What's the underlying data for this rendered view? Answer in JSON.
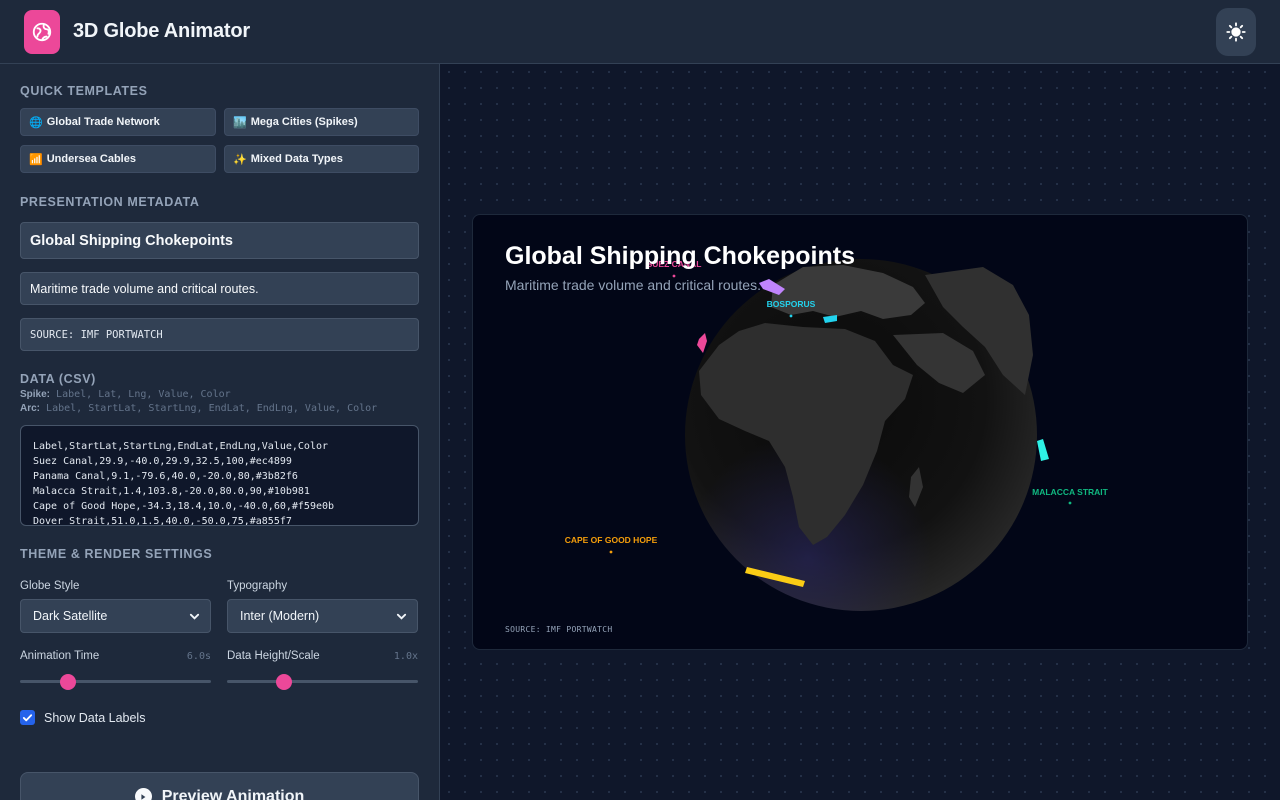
{
  "app": {
    "title": "3D Globe Animator"
  },
  "sidebar": {
    "templates_title": "Quick Templates",
    "templates": [
      {
        "emoji": "🌐",
        "label": "Global Trade Network"
      },
      {
        "emoji": "🏙️",
        "label": "Mega Cities (Spikes)"
      },
      {
        "emoji": "📶",
        "label": "Undersea Cables"
      },
      {
        "emoji": "✨",
        "label": "Mixed Data Types"
      }
    ],
    "metadata_title": "Presentation Metadata",
    "title_value": "Global Shipping Chokepoints",
    "subtitle_value": "Maritime trade volume and critical routes.",
    "source_value": "SOURCE: IMF PORTWATCH",
    "data_title": "Data (CSV)",
    "spike_format_label": "Spike:",
    "spike_format": "Label, Lat, Lng, Value, Color",
    "arc_format_label": "Arc:",
    "arc_format": "Label, StartLat, StartLng, EndLat, EndLng, Value, Color",
    "csv_lines": [
      "Label,StartLat,StartLng,EndLat,EndLng,Value,Color",
      "Suez Canal,29.9,-40.0,29.9,32.5,100,#ec4899",
      "Panama Canal,9.1,-79.6,40.0,-20.0,80,#3b82f6",
      "Malacca Strait,1.4,103.8,-20.0,80.0,90,#10b981",
      "Cape of Good Hope,-34.3,18.4,10.0,-40.0,60,#f59e0b",
      "Dover Strait,51.0,1.5,40.0,-50.0,75,#a855f7"
    ],
    "theme_title": "Theme & Render Settings",
    "globe_style_label": "Globe Style",
    "globe_style_value": "Dark Satellite",
    "typography_label": "Typography",
    "typography_value": "Inter (Modern)",
    "anim_time_label": "Animation Time",
    "anim_time_value": "6.0s",
    "anim_time_fraction": 0.25,
    "height_label": "Data Height/Scale",
    "height_value": "1.0x",
    "height_fraction": 0.3,
    "show_labels_label": "Show Data Labels",
    "show_labels_checked": true,
    "preview_label": "Preview Animation"
  },
  "preview": {
    "title": "Global Shipping Chokepoints",
    "subtitle": "Maritime trade volume and critical routes.",
    "source": "SOURCE: IMF PORTWATCH",
    "labels": {
      "suez": "SUEZ CANAL",
      "bosporus": "BOSPORUS",
      "malacca": "MALACCA STRAIT",
      "cape": "CAPE OF GOOD HOPE"
    }
  },
  "colors": {
    "accent": "#ec4899",
    "suez": "#ec4899",
    "bosporus": "#22d3ee",
    "malacca": "#10b981",
    "cape": "#f59e0b",
    "spike_cyan": "#2ef2e6",
    "spike_yellow": "#facc15",
    "spike_purple": "#c084fc"
  },
  "icons": {
    "logo": "globe-link-icon",
    "theme": "sun-icon",
    "select": "chevron-down-icon",
    "play": "play-circle-icon",
    "check": "check-icon"
  }
}
